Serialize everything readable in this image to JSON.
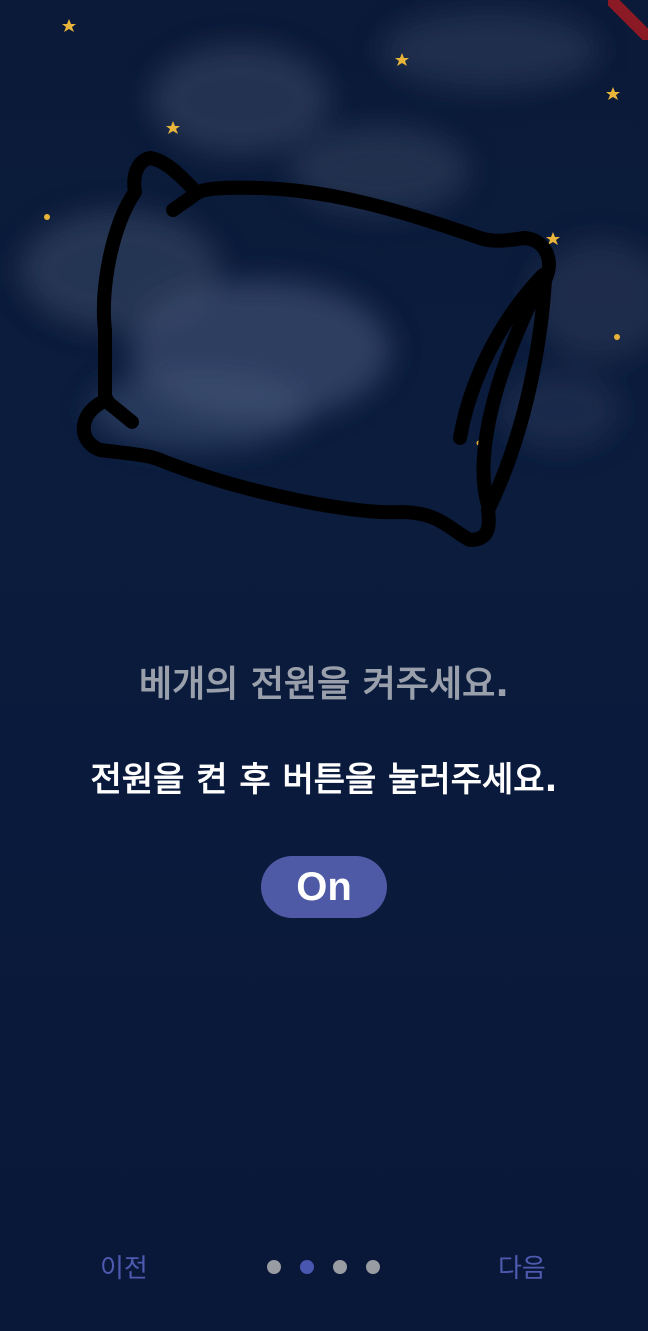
{
  "screen": {
    "title": "베개의 전원을 켜주세요.",
    "subtitle": "전원을 켠 후 버튼을 눌러주세요."
  },
  "illustration": {
    "icon": "pillow-icon",
    "background": "night-sky-clouds-stars"
  },
  "power_button": {
    "label": "On",
    "color": "#4e5aa6"
  },
  "navigation": {
    "prev_label": "이전",
    "next_label": "다음",
    "page_count": 4,
    "current_page": 2,
    "active_color": "#4a57b0",
    "inactive_color": "#9a9ca3"
  },
  "theme": {
    "accent": "#4e5aa6",
    "background": "#0b1a38"
  }
}
